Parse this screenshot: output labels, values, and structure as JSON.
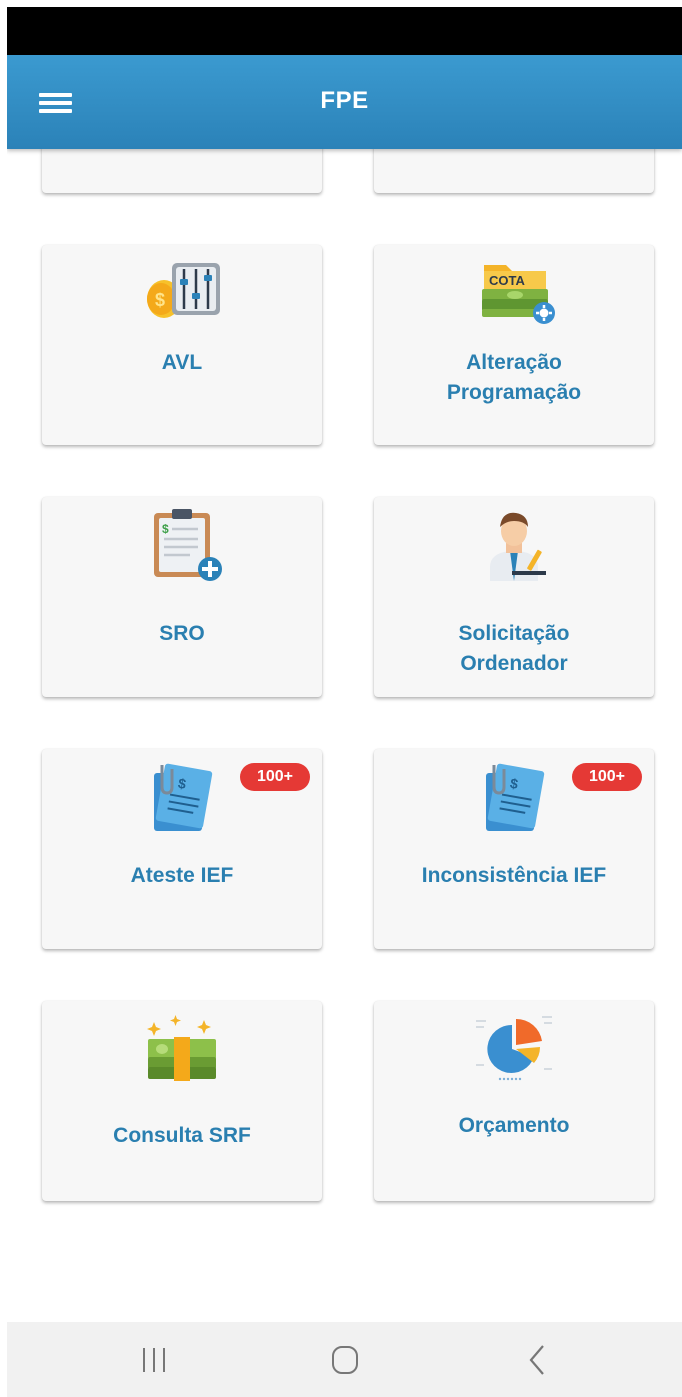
{
  "app_bar": {
    "title": "FPE",
    "menu_icon": "menu-icon"
  },
  "cards": [
    {
      "id": "avl",
      "label_lines": [
        "AVL"
      ],
      "icon": "coin-sliders-icon",
      "badge": null
    },
    {
      "id": "alteracao-programacao",
      "label_lines": [
        "Alteração",
        "Programação"
      ],
      "icon": "cota-folder-icon",
      "icon_text": "COTA",
      "badge": null
    },
    {
      "id": "sro",
      "label_lines": [
        "SRO"
      ],
      "icon": "clipboard-plus-icon",
      "badge": null
    },
    {
      "id": "solicitacao-ordenador",
      "label_lines": [
        "Solicitação",
        "Ordenador"
      ],
      "icon": "man-signing-icon",
      "badge": null
    },
    {
      "id": "ateste-ief",
      "label_lines": [
        "Ateste IEF"
      ],
      "icon": "invoice-clip-icon",
      "badge": "100+"
    },
    {
      "id": "inconsistencia-ief",
      "label_lines": [
        "Inconsistência IEF"
      ],
      "icon": "invoice-clip-icon",
      "badge": "100+"
    },
    {
      "id": "consulta-srf",
      "label_lines": [
        "Consulta SRF"
      ],
      "icon": "money-stack-icon",
      "badge": null
    },
    {
      "id": "orcamento",
      "label_lines": [
        "Orçamento"
      ],
      "icon": "pie-chart-icon",
      "badge": null
    }
  ],
  "nav_bar": {
    "buttons": [
      "recent-apps-icon",
      "home-icon",
      "back-icon"
    ]
  },
  "colors": {
    "app_bar": "#2b82b8",
    "card_label": "#2a7fb0",
    "badge": "#e53935",
    "card_bg": "#f7f7f7"
  }
}
